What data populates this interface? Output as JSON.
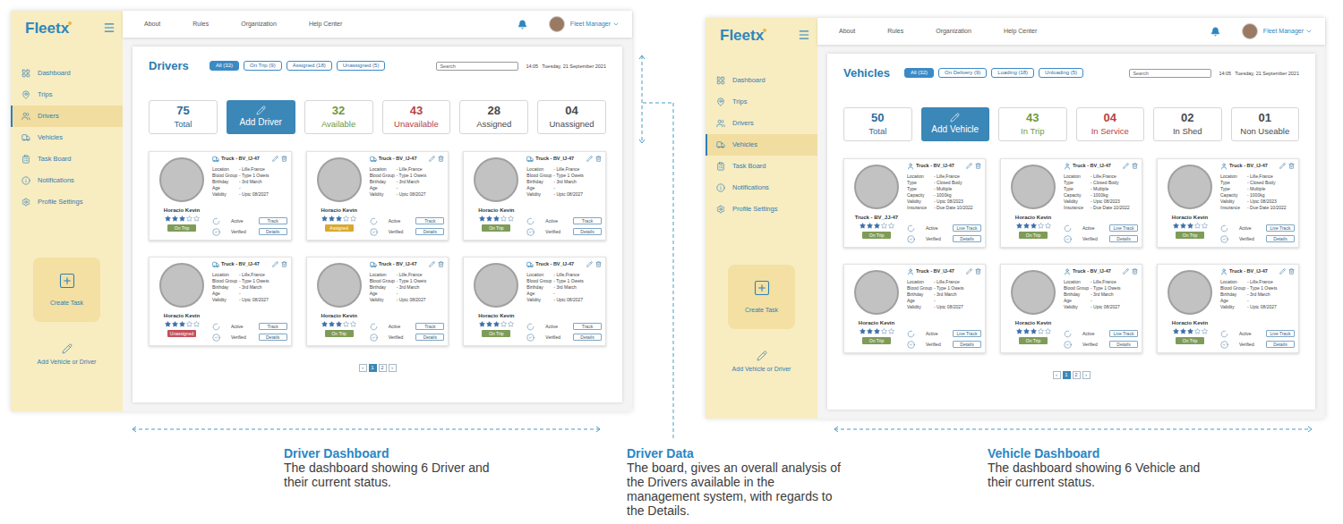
{
  "screens": [
    {
      "kind": "driver",
      "logo": {
        "text": "Fleet",
        "mark": "x"
      },
      "nav": [
        "About",
        "Rules",
        "Organization",
        "Help Center"
      ],
      "user": "Fleet Manager",
      "sidebar": {
        "items": [
          {
            "label": "Dashboard",
            "selected": false
          },
          {
            "label": "Trips",
            "selected": false
          },
          {
            "label": "Drivers",
            "selected": true
          },
          {
            "label": "Vehicles",
            "selected": false
          },
          {
            "label": "Task Board",
            "selected": false
          },
          {
            "label": "Notifications",
            "selected": false
          },
          {
            "label": "Profile Settings",
            "selected": false
          }
        ],
        "create": "Create Task",
        "add": "Add Vehicle or Driver"
      },
      "panel": {
        "title": "Drivers",
        "filters": [
          {
            "label": "All (32)",
            "selected": true
          },
          {
            "label": "On Trip (9)",
            "selected": false
          },
          {
            "label": "Assigned (18)",
            "selected": false
          },
          {
            "label": "Unassigned (5)",
            "selected": false
          }
        ],
        "search": {
          "placeholder": "Search"
        },
        "time": "14:05",
        "date": "Tuesday, 21 September 2021",
        "stats": [
          {
            "kind": "stat",
            "value": "75",
            "label": "Total",
            "color": "#2c6c9c"
          },
          {
            "kind": "button",
            "label": "Add Driver"
          },
          {
            "kind": "stat",
            "value": "32",
            "label": "Available",
            "color": "#6e9a3e"
          },
          {
            "kind": "stat",
            "value": "43",
            "label": "Unavailable",
            "color": "#b8433f"
          },
          {
            "kind": "stat",
            "value": "28",
            "label": "Assigned",
            "color": "#4a4a4a"
          },
          {
            "kind": "stat",
            "value": "04",
            "label": "Unassigned",
            "color": "#4a4a4a"
          }
        ],
        "cards": [
          {
            "title": "Truck - BV_IJ-47",
            "name": "Horacio Kevin",
            "stars": 3,
            "status": "On Trip",
            "color": "#7e9c58",
            "active": "Active",
            "verified": "Verified",
            "buttons": [
              "Track",
              "Details"
            ],
            "fields": [
              {
                "label": "Location",
                "value": "- Lille,France"
              },
              {
                "label": "Blood Group",
                "value": "- Type 1 Owets"
              },
              {
                "label": "Birthday",
                "value": "- 3rd March"
              },
              {
                "label": "Age",
                "value": "-"
              },
              {
                "label": "Validity",
                "value": "- Uptc 08/2027"
              }
            ]
          },
          {
            "title": "Truck - BV_IJ-47",
            "name": "Horacio Kevin",
            "stars": 3,
            "status": "Assigned",
            "color": "#d9a92e",
            "active": "Active",
            "verified": "Verified",
            "buttons": [
              "Track",
              "Details"
            ],
            "fields": [
              {
                "label": "Location",
                "value": "- Lille,France"
              },
              {
                "label": "Blood Group",
                "value": "- Type 1 Owets"
              },
              {
                "label": "Birthday",
                "value": "- 3rd March"
              },
              {
                "label": "Age",
                "value": "-"
              },
              {
                "label": "Validity",
                "value": "- Uptc 08/2027"
              }
            ]
          },
          {
            "title": "Truck - BV_IJ-47",
            "name": "Horacio Kevin",
            "stars": 3,
            "status": "On Trip",
            "color": "#7e9c58",
            "active": "Active",
            "verified": "Verified",
            "buttons": [
              "Track",
              "Details"
            ],
            "fields": [
              {
                "label": "Location",
                "value": "- Lille,France"
              },
              {
                "label": "Blood Group",
                "value": "- Type 1 Owets"
              },
              {
                "label": "Birthday",
                "value": "- 3rd March"
              },
              {
                "label": "Age",
                "value": "-"
              },
              {
                "label": "Validity",
                "value": "- Uptc 08/2027"
              }
            ]
          },
          {
            "title": "Truck - BV_IJ-47",
            "name": "Horacio Kevin",
            "stars": 3,
            "status": "Unassigned",
            "color": "#c4505a",
            "active": "Active",
            "verified": "Verified",
            "buttons": [
              "Track",
              "Details"
            ],
            "fields": [
              {
                "label": "Location",
                "value": "- Lille,France"
              },
              {
                "label": "Blood Group",
                "value": "- Type 1 Owets"
              },
              {
                "label": "Birthday",
                "value": "- 3rd March"
              },
              {
                "label": "Age",
                "value": "-"
              },
              {
                "label": "Validity",
                "value": "- Uptc 08/2027"
              }
            ]
          },
          {
            "title": "Truck - BV_IJ-47",
            "name": "Horacio Kevin",
            "stars": 3,
            "status": "On Trip",
            "color": "#7e9c58",
            "active": "Active",
            "verified": "Verified",
            "buttons": [
              "Track",
              "Details"
            ],
            "fields": [
              {
                "label": "Location",
                "value": "- Lille,France"
              },
              {
                "label": "Blood Group",
                "value": "- Type 1 Owets"
              },
              {
                "label": "Birthday",
                "value": "- 3rd March"
              },
              {
                "label": "Age",
                "value": "-"
              },
              {
                "label": "Validity",
                "value": "- Uptc 08/2027"
              }
            ]
          },
          {
            "title": "Truck - BV_IJ-47",
            "name": "Horacio Kevin",
            "stars": 3,
            "status": "On Trip",
            "color": "#7e9c58",
            "active": "Active",
            "verified": "Verified",
            "buttons": [
              "Track",
              "Details"
            ],
            "fields": [
              {
                "label": "Location",
                "value": "- Lille,France"
              },
              {
                "label": "Blood Group",
                "value": "- Type 1 Owets"
              },
              {
                "label": "Birthday",
                "value": "- 3rd March"
              },
              {
                "label": "Age",
                "value": "-"
              },
              {
                "label": "Validity",
                "value": "- Uptc 08/2027"
              }
            ]
          }
        ],
        "pagination": [
          {
            "label": "‹",
            "selected": false
          },
          {
            "label": "1",
            "selected": true
          },
          {
            "label": "2",
            "selected": false
          },
          {
            "label": "›",
            "selected": false
          }
        ]
      }
    },
    {
      "kind": "vehicle",
      "logo": {
        "text": "Fleet",
        "mark": "x"
      },
      "nav": [
        "About",
        "Rules",
        "Organization",
        "Help Center"
      ],
      "user": "Fleet Manager",
      "sidebar": {
        "items": [
          {
            "label": "Dashboard",
            "selected": false
          },
          {
            "label": "Trips",
            "selected": false
          },
          {
            "label": "Drivers",
            "selected": false
          },
          {
            "label": "Vehicles",
            "selected": true
          },
          {
            "label": "Task Board",
            "selected": false
          },
          {
            "label": "Notifications",
            "selected": false
          },
          {
            "label": "Profile Settings",
            "selected": false
          }
        ],
        "create": "Create Task",
        "add": "Add Vehicle or Driver"
      },
      "panel": {
        "title": "Vehicles",
        "filters": [
          {
            "label": "All (32)",
            "selected": true
          },
          {
            "label": "On Delivery (9)",
            "selected": false
          },
          {
            "label": "Loading (18)",
            "selected": false
          },
          {
            "label": "Unloading (5)",
            "selected": false
          }
        ],
        "search": {
          "placeholder": "Search"
        },
        "time": "14:05",
        "date": "Tuesday, 21 September 2021",
        "stats": [
          {
            "kind": "stat",
            "value": "50",
            "label": "Total",
            "color": "#2c6c9c"
          },
          {
            "kind": "button",
            "label": "Add Vehicle"
          },
          {
            "kind": "stat",
            "value": "43",
            "label": "In Trip",
            "color": "#6e9a3e"
          },
          {
            "kind": "stat",
            "value": "04",
            "label": "In Service",
            "color": "#b8433f"
          },
          {
            "kind": "stat",
            "value": "02",
            "label": "In Shed",
            "color": "#4a4a4a"
          },
          {
            "kind": "stat",
            "value": "01",
            "label": "Non Useable",
            "color": "#4a4a4a"
          }
        ],
        "cards": [
          {
            "title": "Truck - BV_IJ-47",
            "name": "Truck - BV_JJ-47",
            "stars": 3,
            "status": "On Trip",
            "color": "#7e9c58",
            "active": "Active",
            "verified": "Verified",
            "buttons": [
              "Live Track",
              "Details"
            ],
            "fields": [
              {
                "label": "Location",
                "value": "- Lille,France"
              },
              {
                "label": "Type",
                "value": "- Closed Body"
              },
              {
                "label": "Type",
                "value": "- Multiple"
              },
              {
                "label": "Capacity",
                "value": "- 1000kg"
              },
              {
                "label": "Validity",
                "value": "- Uptc 08/2023"
              },
              {
                "label": "Insurance",
                "value": "- Due Date 10/2022"
              }
            ]
          },
          {
            "title": "Truck - BV_IJ-47",
            "name": "Horacio Kevin",
            "stars": 3,
            "status": "On Trip",
            "color": "#7e9c58",
            "active": "Active",
            "verified": "Verified",
            "buttons": [
              "Live Track",
              "Details"
            ],
            "fields": [
              {
                "label": "Location",
                "value": "- Lille,France"
              },
              {
                "label": "Type",
                "value": "- Closed Body"
              },
              {
                "label": "Type",
                "value": "- Multiple"
              },
              {
                "label": "Capacity",
                "value": "- 1000kg"
              },
              {
                "label": "Validity",
                "value": "- Uptc 08/2023"
              },
              {
                "label": "Insurance",
                "value": "- Due Date 10/2022"
              }
            ]
          },
          {
            "title": "Truck - BV_IJ-47",
            "name": "Horacio Kevin",
            "stars": 3,
            "status": "On Trip",
            "color": "#7e9c58",
            "active": "Active",
            "verified": "Verified",
            "buttons": [
              "Live Track",
              "Details"
            ],
            "fields": [
              {
                "label": "Location",
                "value": "- Lille,France"
              },
              {
                "label": "Type",
                "value": "- Closed Body"
              },
              {
                "label": "Type",
                "value": "- Multiple"
              },
              {
                "label": "Capacity",
                "value": "- 1000kg"
              },
              {
                "label": "Validity",
                "value": "- Uptc 08/2023"
              },
              {
                "label": "Insurance",
                "value": "- Due Date 10/2022"
              }
            ]
          },
          {
            "title": "Truck - BV_IJ-47",
            "name": "Horacio Kevin",
            "stars": 3,
            "status": "On Trip",
            "color": "#7e9c58",
            "active": "Active",
            "verified": "Verified",
            "buttons": [
              "Live Track",
              "Details"
            ],
            "fields": [
              {
                "label": "Location",
                "value": "- Lille,France"
              },
              {
                "label": "Blood Group",
                "value": "- Type 1 Owets"
              },
              {
                "label": "Birthday",
                "value": "- 3rd March"
              },
              {
                "label": "Age",
                "value": "-"
              },
              {
                "label": "Validity",
                "value": "- Uptc 08/2027"
              }
            ]
          },
          {
            "title": "Truck - BV_IJ-47",
            "name": "Horacio Kevin",
            "stars": 3,
            "status": "On Trip",
            "color": "#7e9c58",
            "active": "Active",
            "verified": "Verified",
            "buttons": [
              "Live Track",
              "Details"
            ],
            "fields": [
              {
                "label": "Location",
                "value": "- Lille,France"
              },
              {
                "label": "Blood Group",
                "value": "- Type 1 Owets"
              },
              {
                "label": "Birthday",
                "value": "- 3rd March"
              },
              {
                "label": "Age",
                "value": "-"
              },
              {
                "label": "Validity",
                "value": "- Uptc 08/2027"
              }
            ]
          },
          {
            "title": "Truck - BV_IJ-47",
            "name": "Horacio Kevin",
            "stars": 3,
            "status": "On Trip",
            "color": "#7e9c58",
            "active": "Active",
            "verified": "Verified",
            "buttons": [
              "Live Track",
              "Details"
            ],
            "fields": [
              {
                "label": "Location",
                "value": "- Lille,France"
              },
              {
                "label": "Blood Group",
                "value": "- Type 1 Owets"
              },
              {
                "label": "Birthday",
                "value": "- 3rd March"
              },
              {
                "label": "Age",
                "value": "-"
              },
              {
                "label": "Validity",
                "value": "- Uptc 08/2027"
              }
            ]
          }
        ],
        "pagination": [
          {
            "label": "‹",
            "selected": false
          },
          {
            "label": "1",
            "selected": true
          },
          {
            "label": "2",
            "selected": false
          },
          {
            "label": "›",
            "selected": false
          }
        ]
      }
    }
  ],
  "captions": [
    {
      "title": "Driver Dashboard",
      "body": "The dashboard showing 6 Driver and their current status."
    },
    {
      "title": "Driver Data",
      "body": "The board, gives an overall analysis of the Drivers available in the management system, with regards to the Details."
    },
    {
      "title": "Vehicle Dashboard",
      "body": "The dashboard showing 6 Vehicle and their current status."
    }
  ]
}
